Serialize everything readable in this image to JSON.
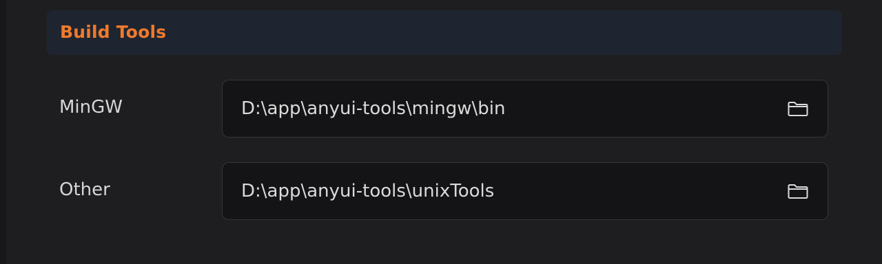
{
  "section": {
    "title": "Build Tools"
  },
  "rows": [
    {
      "label": "MinGW",
      "value": "D:\\app\\anyui-tools\\mingw\\bin",
      "icon": "folder-icon"
    },
    {
      "label": "Other",
      "value": "D:\\app\\anyui-tools\\unixTools",
      "icon": "folder-icon"
    }
  ],
  "colors": {
    "background": "#1e1e20",
    "header_background": "#1f2530",
    "accent": "#f07a2c",
    "field_background": "#141416",
    "text": "#d6d6d6"
  }
}
